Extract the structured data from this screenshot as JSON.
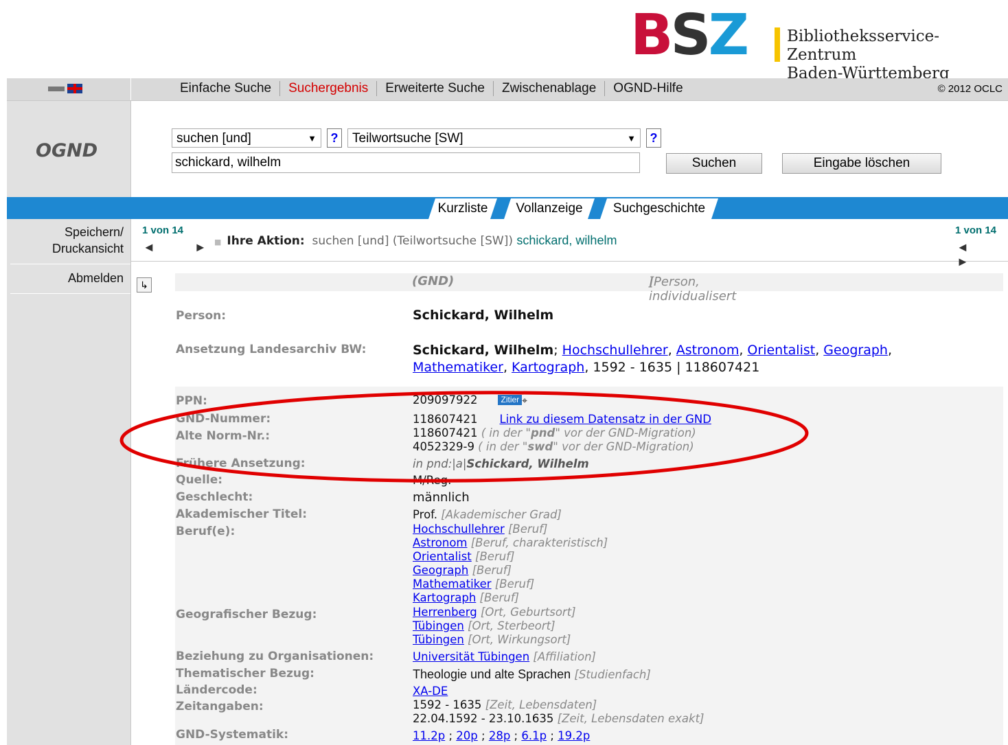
{
  "header": {
    "logo_letters": [
      "B",
      "S",
      "Z"
    ],
    "logo_colors": [
      "#c8103a",
      "#333333",
      "#1a9ad6"
    ],
    "org_name_line1": "Bibliotheksservice-Zentrum",
    "org_name_line2": "Baden-Württemberg"
  },
  "nav": {
    "items": [
      {
        "label": "Einfache Suche",
        "active": false
      },
      {
        "label": "Suchergebnis",
        "active": true
      },
      {
        "label": "Erweiterte Suche",
        "active": false
      },
      {
        "label": "Zwischenablage",
        "active": false
      },
      {
        "label": "OGND-Hilfe",
        "active": false
      }
    ],
    "copyright": "© 2012 OCLC",
    "lang_icons": [
      "german-flag-icon",
      "uk-flag-icon"
    ]
  },
  "search": {
    "app_title": "OGND",
    "operator_select": "suchen [und]",
    "index_select": "Teilwortsuche [SW]",
    "help_label": "?",
    "query": "schickard, wilhelm",
    "submit_label": "Suchen",
    "clear_label": "Eingabe löschen"
  },
  "tabs": [
    "Kurzliste",
    "Vollanzeige",
    "Suchgeschichte"
  ],
  "sidebar": {
    "save_line1": "Speichern/",
    "save_line2": "Druckansicht",
    "logout": "Abmelden"
  },
  "action": {
    "page_left": "1 von 14",
    "page_right": "1 von 14",
    "label": "Ihre Aktion:",
    "text": "suchen [und] (Teilwortsuche [SW])",
    "query": "schickard, wilhelm",
    "arrows": "◄ ►"
  },
  "record": {
    "type_prefix": "[Person, individualisert ",
    "type_bold": "(GND)",
    "type_suffix": "]",
    "person_label": "Person:",
    "person_value": "Schickard, Wilhelm",
    "landes_label": "Ansetzung Landesarchiv BW:",
    "landes_name": "Schickard, Wilhelm",
    "landes_links1": [
      "Hochschullehrer",
      "Astronom",
      "Orientalist",
      "Geograph"
    ],
    "landes_links2": [
      "Mathematiker",
      "Kartograph"
    ],
    "landes_tail": ", 1592 - 1635 | 118607421",
    "ppn_label": "PPN:",
    "ppn_value": "209097922",
    "zitier": "Zitier",
    "gnd_label": "GND-Nummer:",
    "gnd_value": "118607421",
    "gnd_link": "Link zu diesem Datensatz in der GND",
    "alt_label": "Alte Norm-Nr.:",
    "alt1_value": "118607421",
    "alt1_hint_a": " ( in der \"",
    "alt1_hint_b": "pnd",
    "alt1_hint_c": "\" vor der GND-Migration)",
    "alt2_value": "4052329-9",
    "alt2_hint_b": "swd",
    "frueher_label": "Frühere Ansetzung:",
    "frueher_prefix": "in pnd:|a|",
    "frueher_name": "Schickard, Wilhelm",
    "quelle_label": "Quelle:",
    "quelle_value": "M/Reg.",
    "geschlecht_label": "Geschlecht:",
    "geschlecht_value": "männlich",
    "titel_label": "Akademischer Titel:",
    "titel_value": "Prof.",
    "titel_hint": "[Akademischer Grad]",
    "beruf_label": "Beruf(e):",
    "berufe": [
      {
        "name": "Hochschullehrer",
        "hint": "[Beruf]"
      },
      {
        "name": "Astronom",
        "hint": "[Beruf, charakteristisch]"
      },
      {
        "name": "Orientalist",
        "hint": "[Beruf]"
      },
      {
        "name": "Geograph",
        "hint": "[Beruf]"
      },
      {
        "name": "Mathematiker",
        "hint": "[Beruf]"
      },
      {
        "name": "Kartograph",
        "hint": "[Beruf]"
      }
    ],
    "geo_label": "Geografischer Bezug:",
    "geo": [
      {
        "name": "Herrenberg",
        "hint": "[Ort, Geburtsort]"
      },
      {
        "name": "Tübingen",
        "hint": "[Ort, Sterbeort]"
      },
      {
        "name": "Tübingen",
        "hint": "[Ort, Wirkungsort]"
      }
    ],
    "org_label": "Beziehung zu Organisationen:",
    "org_value": "Universität Tübingen",
    "org_hint": "[Affiliation]",
    "thema_label": "Thematischer Bezug:",
    "thema_value": "Theologie und alte Sprachen",
    "thema_hint": "[Studienfach]",
    "land_label": "Ländercode:",
    "land_value": "XA-DE",
    "zeit_label": "Zeitangaben:",
    "zeit1_value": "1592 - 1635",
    "zeit1_hint": "[Zeit, Lebensdaten]",
    "zeit2_value": "22.04.1592 - 23.10.1635",
    "zeit2_hint": "[Zeit, Lebensdaten exakt]",
    "syst_label": "GND-Systematik:",
    "syst": [
      "11.2p",
      "20p",
      "28p",
      "6.1p",
      "19.2p"
    ]
  },
  "annotation_color": "#e00000"
}
